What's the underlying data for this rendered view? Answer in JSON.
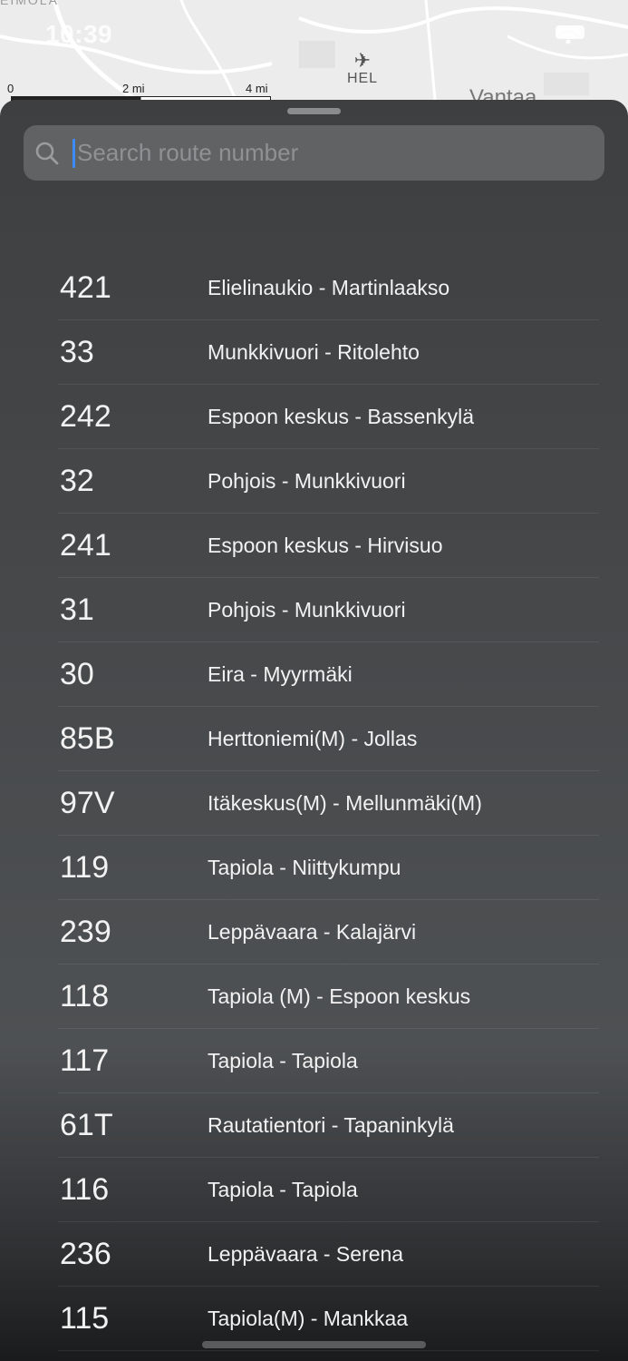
{
  "status_bar": {
    "time": "10:39"
  },
  "map": {
    "top_label": "EIMOLA",
    "scale_labels": [
      "0",
      "2 mi",
      "4 mi"
    ],
    "airport_code": "HEL",
    "place_label": "Vantaa"
  },
  "search": {
    "placeholder": "Search route number",
    "value": ""
  },
  "routes": [
    {
      "number": "421",
      "name": "Elielinaukio - Martinlaakso"
    },
    {
      "number": "33",
      "name": "Munkkivuori - Ritolehto"
    },
    {
      "number": "242",
      "name": "Espoon keskus - Bassenkylä"
    },
    {
      "number": "32",
      "name": "Pohjois - Munkkivuori"
    },
    {
      "number": "241",
      "name": "Espoon keskus - Hirvisuo"
    },
    {
      "number": "31",
      "name": "Pohjois - Munkkivuori"
    },
    {
      "number": "30",
      "name": "Eira - Myyrmäki"
    },
    {
      "number": "85B",
      "name": "Herttoniemi(M) - Jollas"
    },
    {
      "number": "97V",
      "name": "Itäkeskus(M) - Mellunmäki(M)"
    },
    {
      "number": "119",
      "name": "Tapiola - Niittykumpu"
    },
    {
      "number": "239",
      "name": "Leppävaara - Kalajärvi"
    },
    {
      "number": "118",
      "name": "Tapiola (M) - Espoon keskus"
    },
    {
      "number": "117",
      "name": "Tapiola - Tapiola"
    },
    {
      "number": "61T",
      "name": "Rautatientori - Tapaninkylä"
    },
    {
      "number": "116",
      "name": "Tapiola - Tapiola"
    },
    {
      "number": "236",
      "name": "Leppävaara - Serena"
    },
    {
      "number": "115",
      "name": "Tapiola(M) - Mankkaa"
    }
  ]
}
